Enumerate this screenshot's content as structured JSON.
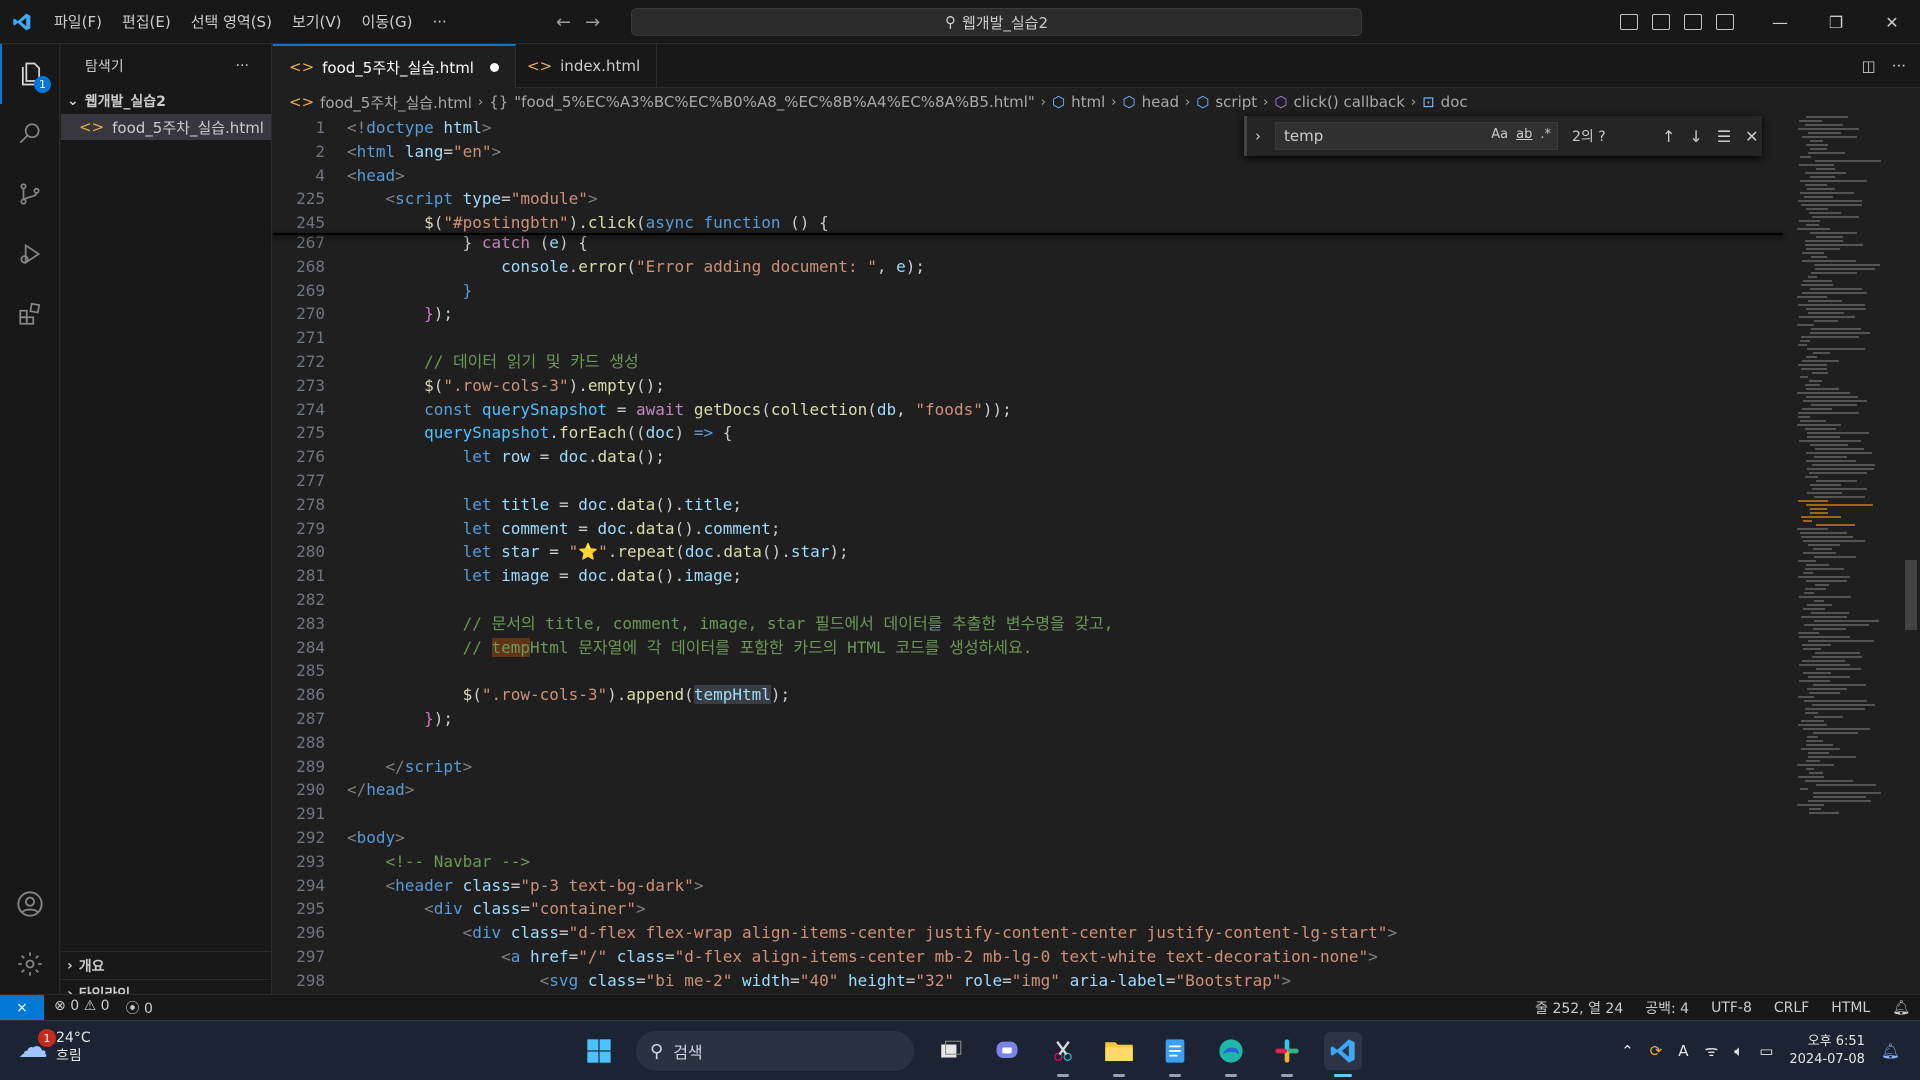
{
  "titlebar": {
    "menu": [
      "파일(F)",
      "편집(E)",
      "선택 영역(S)",
      "보기(V)",
      "이동(G)",
      "···"
    ],
    "search": "웹개발_실습2"
  },
  "sidebar": {
    "title": "탐색기",
    "more": "···",
    "folder": "웹개발_실습2",
    "file": "food_5주차_실습.html",
    "outline": "개요",
    "timeline": "타임라인",
    "explorer_badge": "1"
  },
  "tabs": [
    {
      "label": "food_5주차_실습.html",
      "modified": true
    },
    {
      "label": "index.html",
      "modified": false
    }
  ],
  "breadcrumb": [
    "food_5주차_실습.html",
    "\"food_5%EC%A3%BC%EC%B0%A8_%EC%8B%A4%EC%8A%B5.html\"",
    "html",
    "head",
    "script",
    "click() callback",
    "doc"
  ],
  "find": {
    "query": "temp",
    "count": "2의 ?",
    "opt_case": "Aa",
    "opt_word": "ab",
    "opt_regex": ".*"
  },
  "code": [
    {
      "n": "1",
      "html": "<span style=\"color:#808080\">&lt;!</span><span style=\"color:#569cd6\">doctype</span> <span style=\"color:#9cdcfe\">html</span><span style=\"color:#808080\">&gt;</span>"
    },
    {
      "n": "2",
      "html": "<span style=\"color:#808080\">&lt;</span><span style=\"color:#569cd6\">html</span> <span style=\"color:#9cdcfe\">lang</span>=<span style=\"color:#ce9178\">\"en\"</span><span style=\"color:#808080\">&gt;</span>"
    },
    {
      "n": "4",
      "html": "<span style=\"color:#808080\">&lt;</span><span style=\"color:#569cd6\">head</span><span style=\"color:#808080\">&gt;</span>"
    },
    {
      "n": "225",
      "html": "    <span style=\"color:#808080\">&lt;</span><span style=\"color:#569cd6\">script</span> <span style=\"color:#9cdcfe\">type</span>=<span style=\"color:#ce9178\">\"module\"</span><span style=\"color:#808080\">&gt;</span>"
    },
    {
      "n": "245",
      "html": "        <span style=\"color:#dcdcaa\">$</span>(<span style=\"color:#ce9178\">\"#postingbtn\"</span>).<span style=\"color:#dcdcaa\">click</span>(<span style=\"color:#569cd6\">async</span> <span style=\"color:#569cd6\">function</span> () {"
    },
    {
      "n": "267",
      "html": "            } <span style=\"color:#c586c0\">catch</span> (<span style=\"color:#9cdcfe\">e</span>) {"
    },
    {
      "n": "268",
      "html": "                <span style=\"color:#9cdcfe\">console</span>.<span style=\"color:#dcdcaa\">error</span>(<span style=\"color:#ce9178\">\"Error adding document: \"</span>, <span style=\"color:#9cdcfe\">e</span>);"
    },
    {
      "n": "269",
      "html": "            <span style=\"color:#569cd6\">}</span>"
    },
    {
      "n": "270",
      "html": "        <span style=\"color:#da70d6\">}</span>);"
    },
    {
      "n": "271",
      "html": ""
    },
    {
      "n": "272",
      "html": "        <span style=\"color:#6a9955\">// 데이터 읽기 및 카드 생성</span>"
    },
    {
      "n": "273",
      "html": "        <span style=\"color:#dcdcaa\">$</span>(<span style=\"color:#ce9178\">\".row-cols-3\"</span>).<span style=\"color:#dcdcaa\">empty</span>();"
    },
    {
      "n": "274",
      "html": "        <span style=\"color:#569cd6\">const</span> <span style=\"color:#4fc1ff\">querySnapshot</span> = <span style=\"color:#c586c0\">await</span> <span style=\"color:#dcdcaa\">getDocs</span>(<span style=\"color:#dcdcaa\">collection</span>(<span style=\"color:#9cdcfe\">db</span>, <span style=\"color:#ce9178\">\"foods\"</span>));"
    },
    {
      "n": "275",
      "html": "        <span style=\"color:#4fc1ff\">querySnapshot</span>.<span style=\"color:#dcdcaa\">forEach</span>((<span style=\"color:#9cdcfe\">doc</span>) <span style=\"color:#569cd6\">=&gt;</span> {"
    },
    {
      "n": "276",
      "html": "            <span style=\"color:#569cd6\">let</span> <span style=\"color:#9cdcfe\">row</span> = <span style=\"color:#9cdcfe\">doc</span>.<span style=\"color:#dcdcaa\">data</span>();"
    },
    {
      "n": "277",
      "html": ""
    },
    {
      "n": "278",
      "html": "            <span style=\"color:#569cd6\">let</span> <span style=\"color:#9cdcfe\">title</span> = <span style=\"color:#9cdcfe\">doc</span>.<span style=\"color:#dcdcaa\">data</span>().<span style=\"color:#9cdcfe\">title</span>;"
    },
    {
      "n": "279",
      "html": "            <span style=\"color:#569cd6\">let</span> <span style=\"color:#9cdcfe\">comment</span> = <span style=\"color:#9cdcfe\">doc</span>.<span style=\"color:#dcdcaa\">data</span>().<span style=\"color:#9cdcfe\">comment</span>;"
    },
    {
      "n": "280",
      "html": "            <span style=\"color:#569cd6\">let</span> <span style=\"color:#9cdcfe\">star</span> = <span style=\"color:#ce9178\">\"⭐\"</span>.<span style=\"color:#dcdcaa\">repeat</span>(<span style=\"color:#9cdcfe\">doc</span>.<span style=\"color:#dcdcaa\">data</span>().<span style=\"color:#9cdcfe\">star</span>);"
    },
    {
      "n": "281",
      "html": "            <span style=\"color:#569cd6\">let</span> <span style=\"color:#9cdcfe\">image</span> = <span style=\"color:#9cdcfe\">doc</span>.<span style=\"color:#dcdcaa\">data</span>().<span style=\"color:#9cdcfe\">image</span>;"
    },
    {
      "n": "282",
      "html": ""
    },
    {
      "n": "283",
      "html": "            <span style=\"color:#6a9955\">// 문서의 title, comment, image, star 필드에서 데이터를 추출한 변수명을 갖고,</span>"
    },
    {
      "n": "284",
      "html": "            <span style=\"color:#6a9955\">// <span style=\"background:#623315\">temp</span>Html 문자열에 각 데이터를 포함한 카드의 HTML 코드를 생성하세요.</span>"
    },
    {
      "n": "285",
      "html": ""
    },
    {
      "n": "286",
      "html": "            <span style=\"color:#dcdcaa\">$</span>(<span style=\"color:#ce9178\">\".row-cols-3\"</span>).<span style=\"color:#dcdcaa\">append</span>(<span style=\"color:#9cdcfe;background:#3a3d41\">tempHtml</span>);"
    },
    {
      "n": "287",
      "html": "        <span style=\"color:#da70d6\">}</span>);"
    },
    {
      "n": "288",
      "html": ""
    },
    {
      "n": "289",
      "html": "    <span style=\"color:#808080\">&lt;/</span><span style=\"color:#569cd6\">script</span><span style=\"color:#808080\">&gt;</span>"
    },
    {
      "n": "290",
      "html": "<span style=\"color:#808080\">&lt;/</span><span style=\"color:#569cd6\">head</span><span style=\"color:#808080\">&gt;</span>"
    },
    {
      "n": "291",
      "html": ""
    },
    {
      "n": "292",
      "html": "<span style=\"color:#808080\">&lt;</span><span style=\"color:#569cd6\">body</span><span style=\"color:#808080\">&gt;</span>"
    },
    {
      "n": "293",
      "html": "    <span style=\"color:#6a9955\">&lt;!-- Navbar --&gt;</span>"
    },
    {
      "n": "294",
      "html": "    <span style=\"color:#808080\">&lt;</span><span style=\"color:#569cd6\">header</span> <span style=\"color:#9cdcfe\">class</span>=<span style=\"color:#ce9178\">\"p-3 text-bg-dark\"</span><span style=\"color:#808080\">&gt;</span>"
    },
    {
      "n": "295",
      "html": "        <span style=\"color:#808080\">&lt;</span><span style=\"color:#569cd6\">div</span> <span style=\"color:#9cdcfe\">class</span>=<span style=\"color:#ce9178\">\"container\"</span><span style=\"color:#808080\">&gt;</span>"
    },
    {
      "n": "296",
      "html": "            <span style=\"color:#808080\">&lt;</span><span style=\"color:#569cd6\">div</span> <span style=\"color:#9cdcfe\">class</span>=<span style=\"color:#ce9178\">\"d-flex flex-wrap align-items-center justify-content-center justify-content-lg-start\"</span><span style=\"color:#808080\">&gt;</span>"
    },
    {
      "n": "297",
      "html": "                <span style=\"color:#808080\">&lt;</span><span style=\"color:#569cd6\">a</span> <span style=\"color:#9cdcfe\">href</span>=<span style=\"color:#ce9178\">\"/\"</span> <span style=\"color:#9cdcfe\">class</span>=<span style=\"color:#ce9178\">\"d-flex align-items-center mb-2 mb-lg-0 text-white text-decoration-none\"</span><span style=\"color:#808080\">&gt;</span>"
    },
    {
      "n": "298",
      "html": "                    <span style=\"color:#808080\">&lt;</span><span style=\"color:#569cd6\">svg</span> <span style=\"color:#9cdcfe\">class</span>=<span style=\"color:#ce9178\">\"bi me-2\"</span> <span style=\"color:#9cdcfe\">width</span>=<span style=\"color:#ce9178\">\"40\"</span> <span style=\"color:#9cdcfe\">height</span>=<span style=\"color:#ce9178\">\"32\"</span> <span style=\"color:#9cdcfe\">role</span>=<span style=\"color:#ce9178\">\"img\"</span> <span style=\"color:#9cdcfe\">aria-label</span>=<span style=\"color:#ce9178\">\"Bootstrap\"</span><span style=\"color:#808080\">&gt;</span>"
    }
  ],
  "status": {
    "errors": "0",
    "warnings": "0",
    "ports": "0",
    "position": "줄 252, 열 24",
    "spaces": "공백: 4",
    "encoding": "UTF-8",
    "eol": "CRLF",
    "language": "HTML"
  },
  "taskbar": {
    "temperature": "24°C",
    "weather": "흐림",
    "weather_badge": "1",
    "search": "검색",
    "time": "오후 6:51",
    "date": "2024-07-08"
  },
  "colors": {
    "accent": "#0078d4",
    "editor_bg": "#1f1f1f",
    "chrome_bg": "#181818"
  }
}
